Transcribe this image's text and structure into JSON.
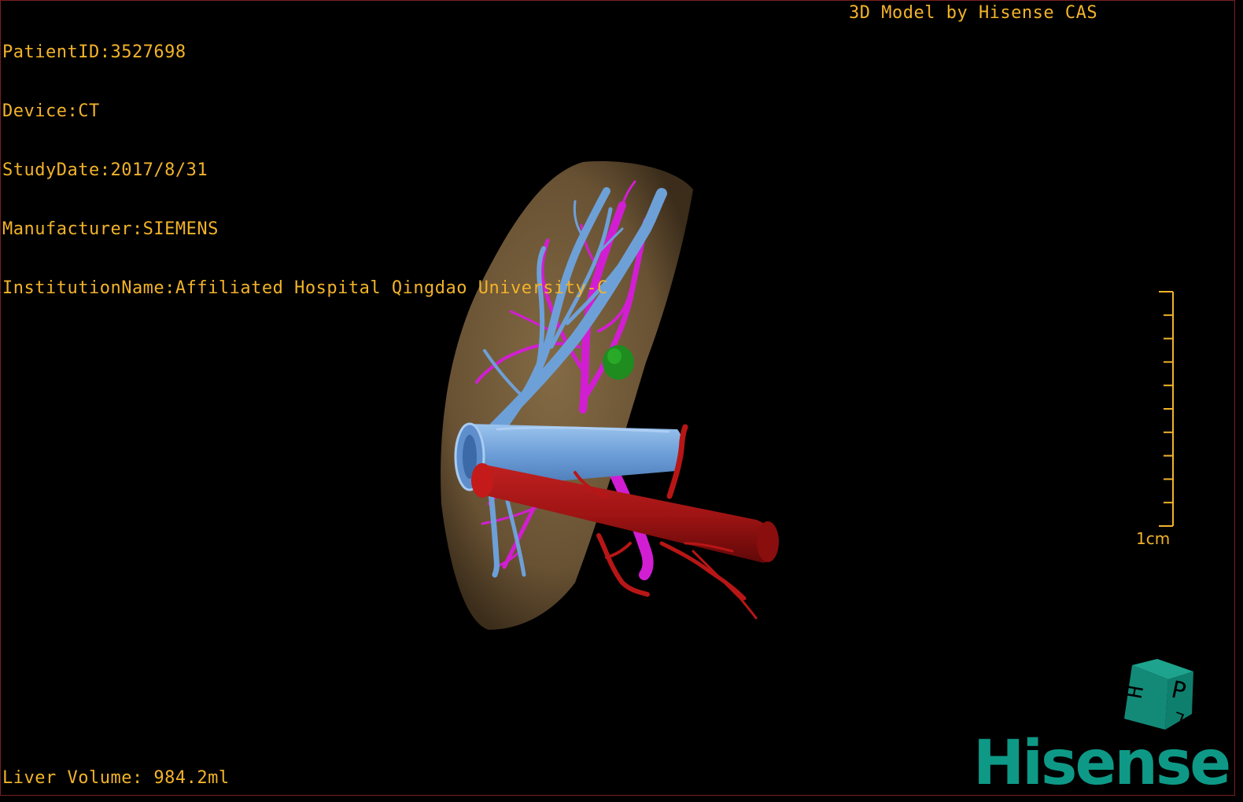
{
  "patient_info": {
    "patient_id": "PatientID:3527698",
    "device": "Device:CT",
    "study_date": "StudyDate:2017/8/31",
    "manufacturer": "Manufacturer:SIEMENS",
    "institution": "InstitutionName:Affiliated Hospital Qingdao University-C"
  },
  "model_credit": "3D Model by Hisense CAS",
  "liver_volume": "Liver Volume: 984.2ml",
  "scale": {
    "label": "1cm",
    "tick_count": 11
  },
  "orientation_cube": {
    "face_front": "P",
    "face_side": "H",
    "face_bottom": "L"
  },
  "brand": "Hisense",
  "colors": {
    "overlay_text": "#f2b32a",
    "liver": "#7a6240",
    "portal_vein": "#6ea0d8",
    "hepatic_vein": "#d21ed2",
    "artery": "#a01414",
    "lesion": "#1e8c1e",
    "brand": "#0e9987"
  }
}
